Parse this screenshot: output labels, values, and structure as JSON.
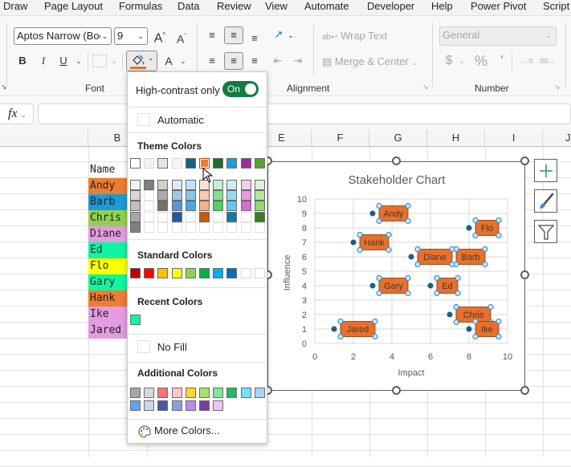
{
  "menu": {
    "tabs": [
      "Draw",
      "Page Layout",
      "Formulas",
      "Data",
      "Review",
      "View",
      "Automate",
      "Developer",
      "Help",
      "Power Pivot",
      "Script"
    ]
  },
  "ribbon": {
    "font_name": "Aptos Narrow (Body)",
    "font_size": "9",
    "bold": "B",
    "italic": "I",
    "underline": "U",
    "font_color_glyph": "A",
    "grow_font_glyph": "A",
    "shrink_font_glyph": "A",
    "wrap_text": "Wrap Text",
    "merge_center": "Merge & Center",
    "number_format": "General",
    "currency": "$",
    "percent": "%",
    "comma": "9",
    "group_font": "Font",
    "group_alignment": "Alignment",
    "group_number": "Number",
    "fill_color": "#e8702a"
  },
  "formula_bar": {
    "fx_label": "fx",
    "value": ""
  },
  "columns": [
    "B",
    "E",
    "F",
    "G",
    "H",
    "I",
    "J"
  ],
  "cells": {
    "header": "Name",
    "names": [
      {
        "text": "Andy",
        "fill": "#ed7d31"
      },
      {
        "text": "Barb",
        "fill": "#1e9ad6"
      },
      {
        "text": "Chris",
        "fill": "#92d050"
      },
      {
        "text": "Diane",
        "fill": "#e39ce0"
      },
      {
        "text": "Ed",
        "fill": "#10f5a0"
      },
      {
        "text": "Flo",
        "fill": "#ffff00"
      },
      {
        "text": "Gary",
        "fill": "#10f5a0"
      },
      {
        "text": "Hank",
        "fill": "#ed7d31"
      },
      {
        "text": "Ike",
        "fill": "#e39ce0"
      },
      {
        "text": "Jared",
        "fill": "#e39ce0"
      }
    ]
  },
  "dropdown": {
    "high_contrast_label": "High-contrast only",
    "toggle_label": "On",
    "toggle_on": true,
    "automatic_label": "Automatic",
    "theme_colors_label": "Theme Colors",
    "theme_colors_top": [
      "#ffffff",
      "#f2f2f2",
      "#e7e6e6",
      "#f5f5f5",
      "#1b5e84",
      "#ed7d31",
      "#1e6e2e",
      "#1ca0d9",
      "#a12b95",
      "#4ea72e"
    ],
    "theme_colors_shades": [
      [
        "#f2f2f2",
        "#d9d9d9",
        "#bfbfbf",
        "#a6a6a6",
        "#808080"
      ],
      [
        "#7f7f7f",
        "#ffffff",
        "#ffffff",
        "#ffffff",
        "#ffffff"
      ],
      [
        "#cfcfcf",
        "#aeaaaa",
        "#757171",
        "#ffffff",
        "#ffffff"
      ],
      [
        "#dce9f6",
        "#a4c3e8",
        "#5796db",
        "#205a9e",
        "#ffffff"
      ],
      [
        "#c2e3f5",
        "#84c8ea",
        "#43ace0",
        "#ffffff",
        "#ffffff"
      ],
      [
        "#fce3d6",
        "#f8cbad",
        "#f4b183",
        "#c55a11",
        "#ffffff"
      ],
      [
        "#c6efce",
        "#85e08f",
        "#47d65b",
        "#ffffff",
        "#ffffff"
      ],
      [
        "#caeefb",
        "#94dcf4",
        "#5fcaee",
        "#117aa6",
        "#ffffff"
      ],
      [
        "#f2cdee",
        "#e59bdc",
        "#d86ccc",
        "#ffffff",
        "#ffffff"
      ],
      [
        "#dcf4d3",
        "#b3e6a0",
        "#90d870",
        "#3b7d23",
        "#ffffff"
      ]
    ],
    "selected_theme_color": "#ed7d31",
    "standard_colors_label": "Standard Colors",
    "standard_colors": [
      "#c00000",
      "#ff0000",
      "#ffc000",
      "#ffff00",
      "#92d050",
      "#00b050",
      "#00b0f0",
      "#0070c0",
      "#ffffff",
      "#ffffff"
    ],
    "recent_colors_label": "Recent Colors",
    "recent_colors": [
      "#10f5a0"
    ],
    "no_fill_label": "No Fill",
    "additional_colors_label": "Additional Colors",
    "additional_colors": [
      "#a6a6a6",
      "#d9d9d9",
      "#ff7373",
      "#ffc6c6",
      "#ffd336",
      "#a8e36e",
      "#7ae89a",
      "#27b561",
      "#6fe0ff",
      "#9fd6ff",
      "#5ea4f5",
      "#c7d8ff",
      "#4a5aa0",
      "#8c9ce4",
      "#c088f0",
      "#7a3aaa",
      "#f2c2f8"
    ],
    "more_colors_label": "More Colors..."
  },
  "chart_data": {
    "type": "scatter",
    "title": "Stakeholder Chart",
    "xlabel": "Impact",
    "ylabel": "Influence",
    "xlim": [
      0,
      10
    ],
    "ylim": [
      0,
      10
    ],
    "xticks": [
      0,
      2,
      4,
      6,
      8,
      10
    ],
    "yticks": [
      0,
      1,
      2,
      3,
      4,
      5,
      6,
      7,
      8,
      9,
      10
    ],
    "grid": true,
    "marker_color": "#1b5e84",
    "label_fill": "#e8702a",
    "points": [
      {
        "name": "Andy",
        "x": 3,
        "y": 9
      },
      {
        "name": "Barb",
        "x": 7,
        "y": 6
      },
      {
        "name": "Chris",
        "x": 7,
        "y": 2
      },
      {
        "name": "Diane",
        "x": 5,
        "y": 6
      },
      {
        "name": "Ed",
        "x": 6,
        "y": 4
      },
      {
        "name": "Flo",
        "x": 8,
        "y": 8
      },
      {
        "name": "Gary",
        "x": 3,
        "y": 4
      },
      {
        "name": "Hank",
        "x": 2,
        "y": 7
      },
      {
        "name": "Ike",
        "x": 8,
        "y": 1
      },
      {
        "name": "Jared",
        "x": 1,
        "y": 1
      }
    ]
  }
}
